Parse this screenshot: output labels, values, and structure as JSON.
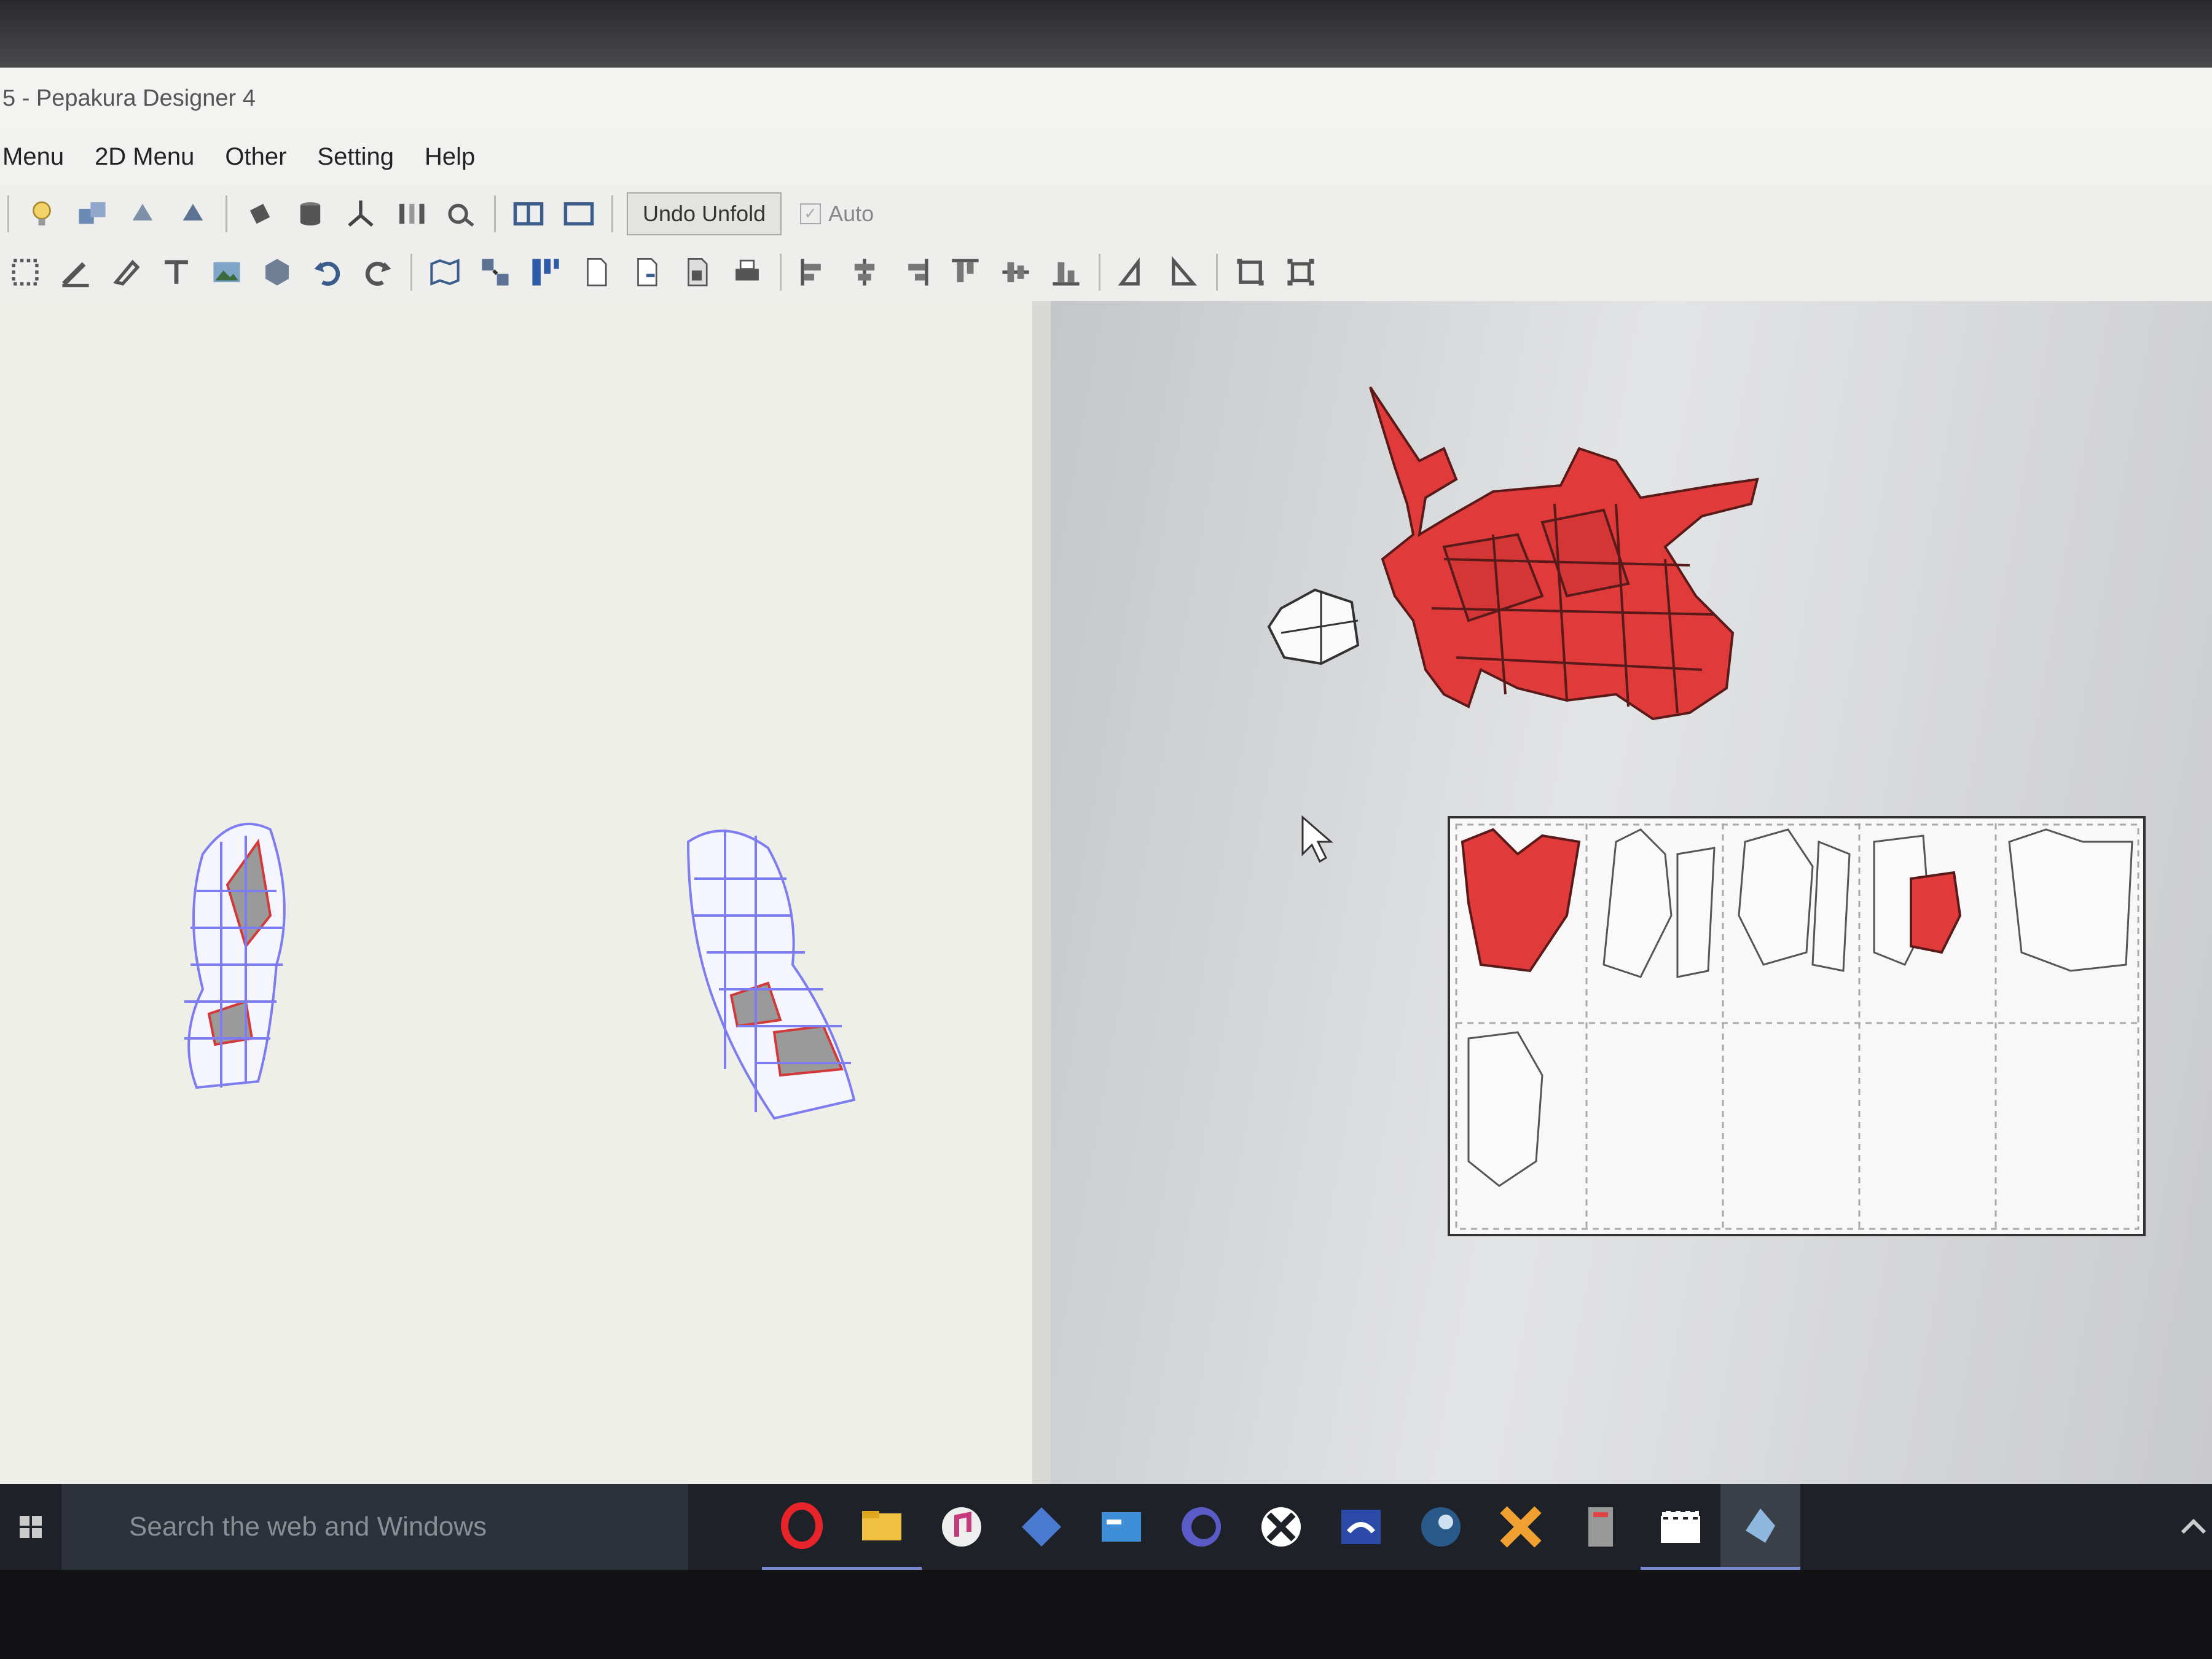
{
  "window": {
    "title": "5 - Pepakura Designer 4"
  },
  "menubar": {
    "items": [
      {
        "label": "Menu"
      },
      {
        "label": "2D Menu"
      },
      {
        "label": "Other"
      },
      {
        "label": "Setting"
      },
      {
        "label": "Help"
      }
    ]
  },
  "toolbar1": {
    "undo_unfold_label": "Undo Unfold",
    "auto_label": "Auto",
    "auto_checked": true,
    "icons": [
      "lightbulb-icon",
      "objects-icon",
      "rotate-left-icon",
      "rotate-right-icon",
      "paint-bucket-icon",
      "cylinder-icon",
      "axis-icon",
      "bars-icon",
      "eye-icon",
      "split-view-icon",
      "single-view-icon"
    ]
  },
  "toolbar2": {
    "icons": [
      "select-icon",
      "pencil-icon",
      "eraser-icon",
      "text-icon",
      "image-icon",
      "cube-icon",
      "undo-icon",
      "redo-icon",
      "map-icon",
      "arrange-icon",
      "grid-icon",
      "page-icon",
      "page-add-icon",
      "page-delete-icon",
      "print-icon",
      "align-left-icon",
      "align-center-icon",
      "align-right-icon",
      "align-top-icon",
      "align-middle-icon",
      "align-bottom-icon",
      "flip-h-icon",
      "flip-v-icon",
      "fit-icon",
      "expand-icon"
    ]
  },
  "taskbar": {
    "search_placeholder": "Search the web and Windows",
    "apps": [
      "opera-icon",
      "file-explorer-icon",
      "itunes-icon",
      "network-icon",
      "mail-icon",
      "browser-icon",
      "xbox-icon",
      "controller-icon",
      "steam-icon",
      "game-icon",
      "server-icon",
      "movie-maker-icon",
      "pepakura-icon"
    ]
  },
  "colors": {
    "selected_parts": "#e03a3a",
    "model_wire": "#7d7df0",
    "accent": "#7b8ad0"
  }
}
